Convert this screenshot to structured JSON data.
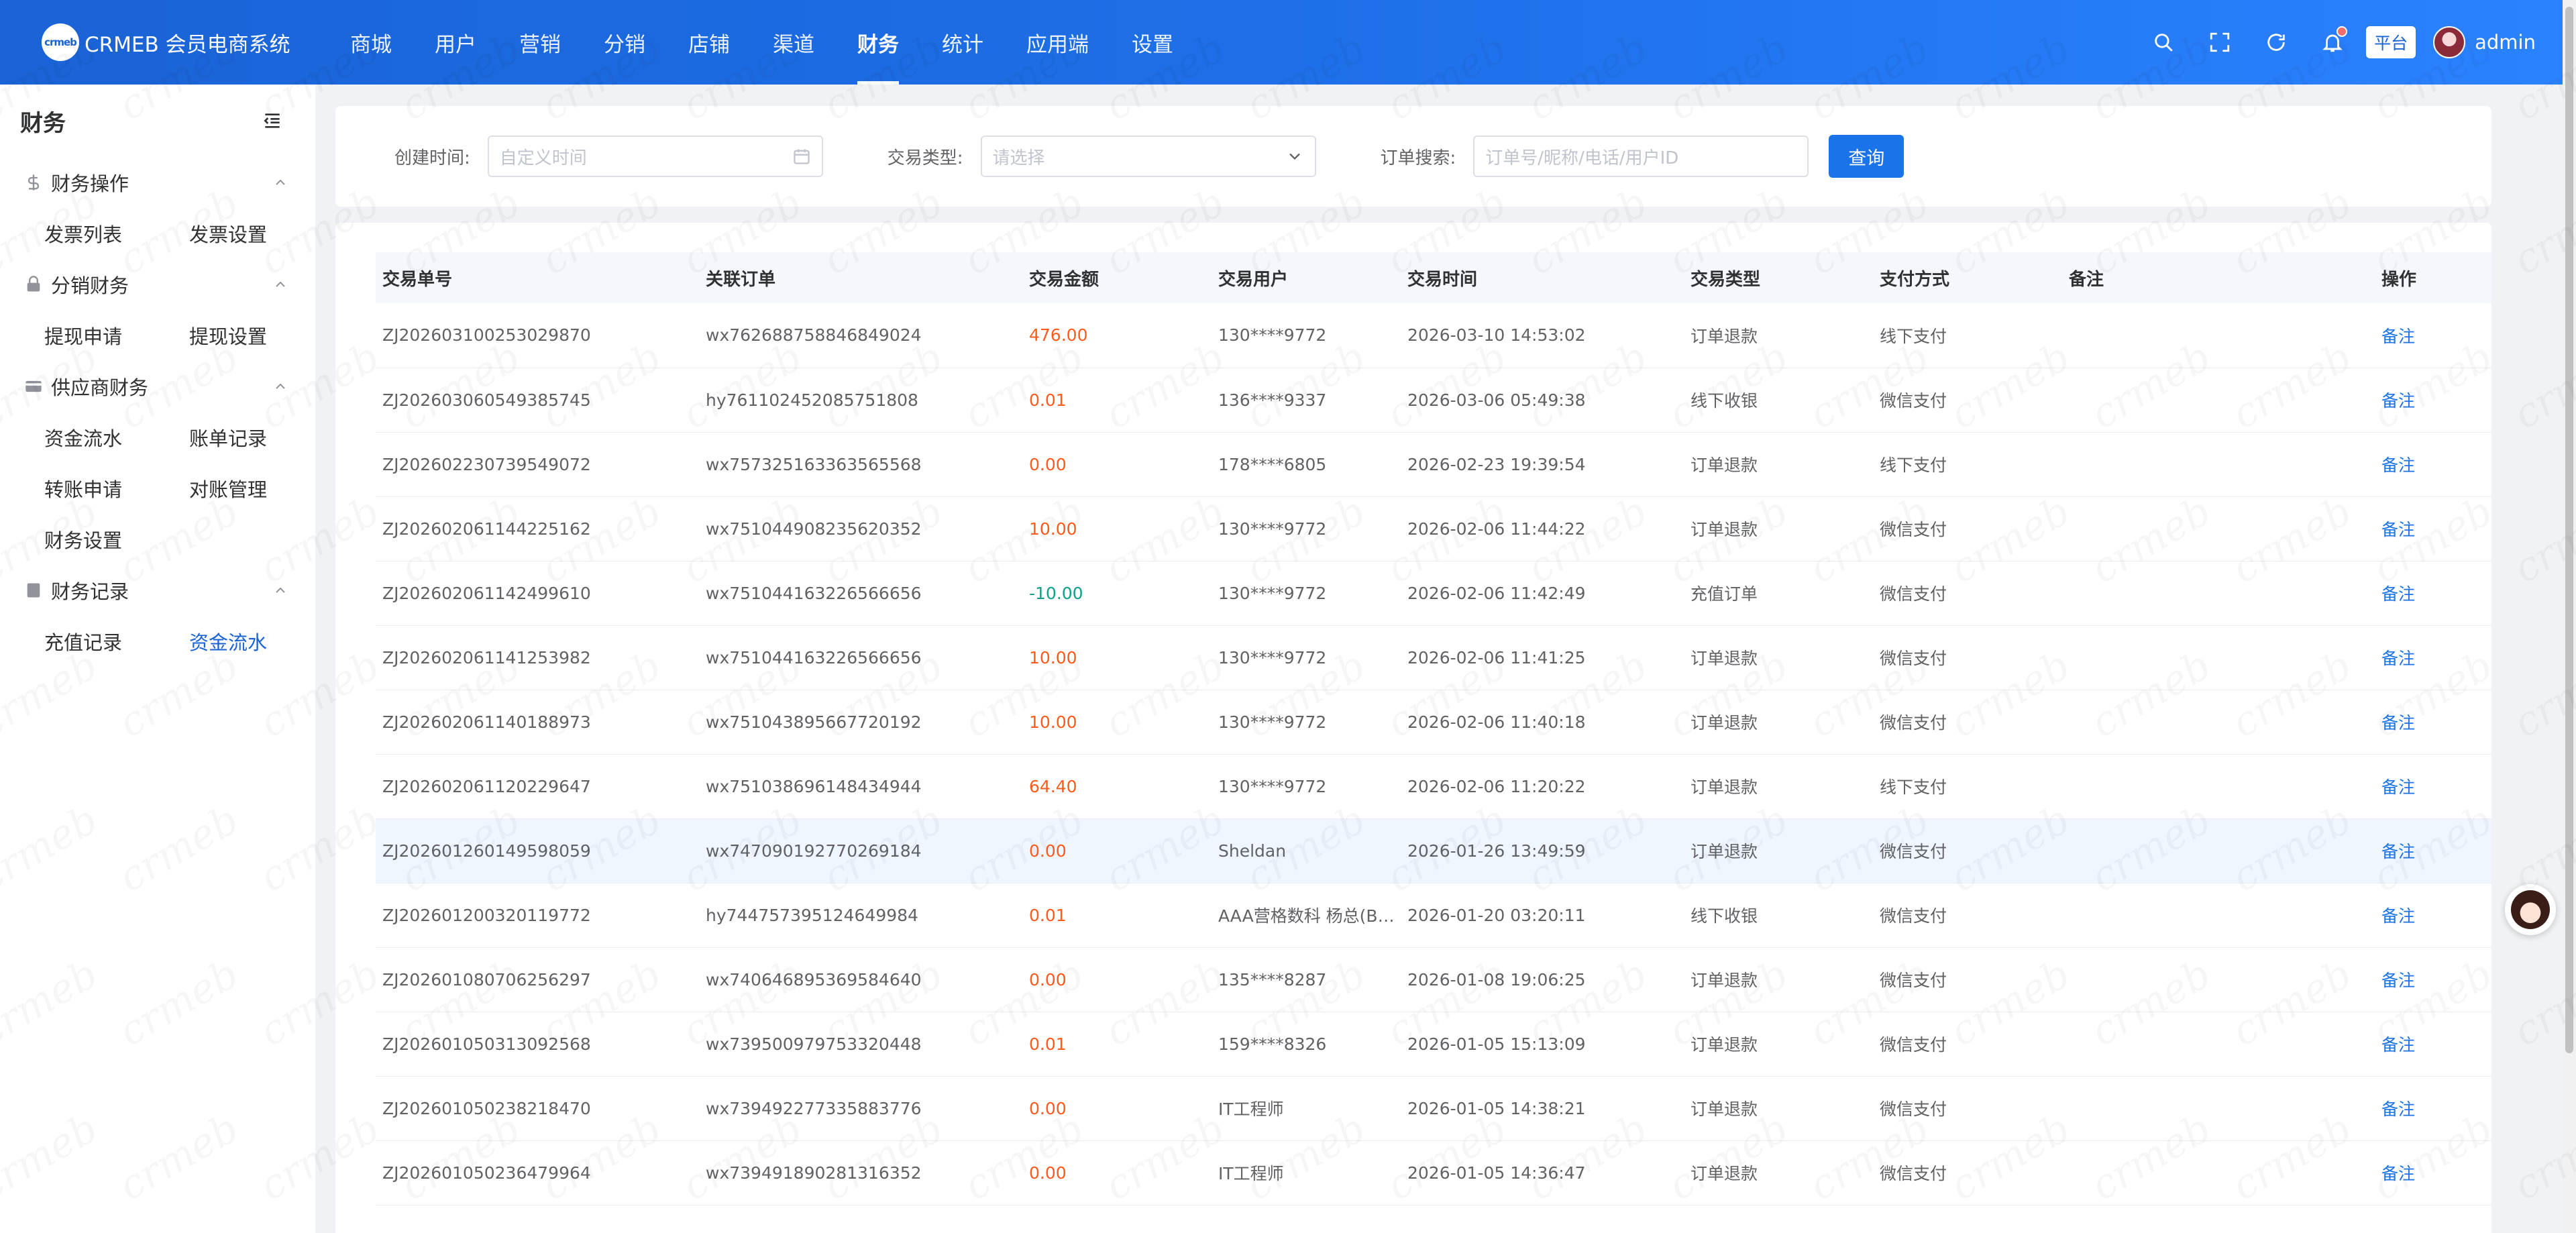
{
  "app": {
    "logo_mark": "crmeb",
    "title": "CRMEB 会员电商系统"
  },
  "topnav": {
    "items": [
      "商城",
      "用户",
      "营销",
      "分销",
      "店铺",
      "渠道",
      "财务",
      "统计",
      "应用端",
      "设置"
    ],
    "active_index": 6
  },
  "header_right": {
    "platform_tag": "平台",
    "username": "admin",
    "icons": [
      "search-icon",
      "fullscreen-icon",
      "refresh-icon",
      "bell-icon"
    ]
  },
  "sidebar": {
    "title": "财务",
    "groups": [
      {
        "label": "财务操作",
        "icon": "dollar-icon",
        "items": [
          "发票列表",
          "发票设置"
        ]
      },
      {
        "label": "分销财务",
        "icon": "lock-icon",
        "items": [
          "提现申请",
          "提现设置"
        ]
      },
      {
        "label": "供应商财务",
        "icon": "card-icon",
        "items": [
          "资金流水",
          "账单记录",
          "转账申请",
          "对账管理",
          "财务设置"
        ]
      },
      {
        "label": "财务记录",
        "icon": "doc-icon",
        "items": [
          "充值记录",
          "资金流水"
        ]
      }
    ],
    "active": "资金流水"
  },
  "filters": {
    "created_time_label": "创建时间:",
    "created_time_placeholder": "自定义时间",
    "type_label": "交易类型:",
    "type_placeholder": "请选择",
    "search_label": "订单搜索:",
    "search_placeholder": "订单号/昵称/电话/用户ID",
    "query_button": "查询"
  },
  "table": {
    "columns": [
      "交易单号",
      "关联订单",
      "交易金额",
      "交易用户",
      "交易时间",
      "交易类型",
      "支付方式",
      "备注",
      "操作"
    ],
    "rows": [
      [
        "ZJ202603100253029870",
        "wx762688758846849024",
        "476.00",
        "130****9772",
        "2026-03-10 14:53:02",
        "订单退款",
        "线下支付",
        "",
        "备注"
      ],
      [
        "ZJ202603060549385745",
        "hy761102452085751808",
        "0.01",
        "136****9337",
        "2026-03-06 05:49:38",
        "线下收银",
        "微信支付",
        "",
        "备注"
      ],
      [
        "ZJ202602230739549072",
        "wx757325163363565568",
        "0.00",
        "178****6805",
        "2026-02-23 19:39:54",
        "订单退款",
        "线下支付",
        "",
        "备注"
      ],
      [
        "ZJ202602061144225162",
        "wx751044908235620352",
        "10.00",
        "130****9772",
        "2026-02-06 11:44:22",
        "订单退款",
        "微信支付",
        "",
        "备注"
      ],
      [
        "ZJ202602061142499610",
        "wx751044163226566656",
        "-10.00",
        "130****9772",
        "2026-02-06 11:42:49",
        "充值订单",
        "微信支付",
        "",
        "备注"
      ],
      [
        "ZJ202602061141253982",
        "wx751044163226566656",
        "10.00",
        "130****9772",
        "2026-02-06 11:41:25",
        "订单退款",
        "微信支付",
        "",
        "备注"
      ],
      [
        "ZJ202602061140188973",
        "wx751043895667720192",
        "10.00",
        "130****9772",
        "2026-02-06 11:40:18",
        "订单退款",
        "微信支付",
        "",
        "备注"
      ],
      [
        "ZJ202602061120229647",
        "wx751038696148434944",
        "64.40",
        "130****9772",
        "2026-02-06 11:20:22",
        "订单退款",
        "线下支付",
        "",
        "备注"
      ],
      [
        "ZJ202601260149598059",
        "wx747090192770269184",
        "0.00",
        "Sheldan",
        "2026-01-26 13:49:59",
        "订单退款",
        "微信支付",
        "",
        "备注"
      ],
      [
        "ZJ202601200320119772",
        "hy744757395124649984",
        "0.01",
        "AAA营格数科 杨总(Bo...",
        "2026-01-20 03:20:11",
        "线下收银",
        "微信支付",
        "",
        "备注"
      ],
      [
        "ZJ202601080706256297",
        "wx740646895369584640",
        "0.00",
        "135****8287",
        "2026-01-08 19:06:25",
        "订单退款",
        "微信支付",
        "",
        "备注"
      ],
      [
        "ZJ202601050313092568",
        "wx739500979753320448",
        "0.01",
        "159****8326",
        "2026-01-05 15:13:09",
        "订单退款",
        "微信支付",
        "",
        "备注"
      ],
      [
        "ZJ202601050238218470",
        "wx739492277335883776",
        "0.00",
        "IT工程师",
        "2026-01-05 14:38:21",
        "订单退款",
        "微信支付",
        "",
        "备注"
      ],
      [
        "ZJ202601050236479964",
        "wx739491890281316352",
        "0.00",
        "IT工程师",
        "2026-01-05 14:36:47",
        "订单退款",
        "微信支付",
        "",
        "备注"
      ]
    ],
    "highlight_row": 8
  },
  "colors": {
    "primary": "#1a73e8",
    "amount_positive": "#ff5b1f",
    "amount_negative": "#12a08a"
  }
}
